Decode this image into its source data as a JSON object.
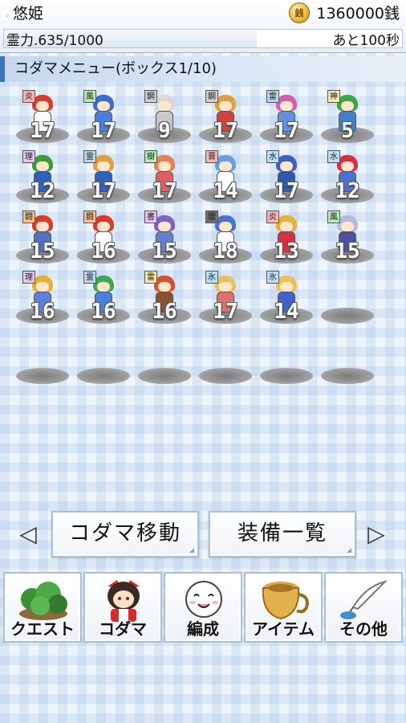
{
  "header": {
    "player_name": "悠姫",
    "coin_icon_glyph": "銭",
    "money": "1360000銭",
    "stamina_label": "霊力.635/1000",
    "stamina_fraction": 0.635,
    "remaining_time": "あと100秒"
  },
  "menu_title": "コダマメニュー(ボックス1/10)",
  "kodama": [
    {
      "badge": "炎",
      "level": "17",
      "badge_color": "#f6b4b4",
      "hair": "#d83c2a",
      "body": "#ffffff"
    },
    {
      "badge": "風",
      "level": "17",
      "badge_color": "#b6ecb6",
      "hair": "#3b6ad0",
      "body": "#4a7fe0"
    },
    {
      "badge": "鋼",
      "level": "9",
      "badge_color": "#d0d0d0",
      "hair": "#d8d8d8",
      "body": "#c8c8c8"
    },
    {
      "badge": "鋼",
      "level": "17",
      "badge_color": "#d0d0d0",
      "hair": "#e0a040",
      "body": "#d84040"
    },
    {
      "badge": "雷",
      "level": "17",
      "badge_color": "#bcd8f0",
      "hair": "#d060b0",
      "body": "#6090e0"
    },
    {
      "badge": "神",
      "level": "5",
      "badge_color": "#f6e8a8",
      "hair": "#38a848",
      "body": "#4080d0"
    },
    {
      "badge": "理",
      "level": "12",
      "badge_color": "#e0c8f0",
      "hair": "#3f9a3f",
      "body": "#3060c0"
    },
    {
      "badge": "霊",
      "level": "17",
      "badge_color": "#bcd8f0",
      "hair": "#e0a040",
      "body": "#3060c0"
    },
    {
      "badge": "樹",
      "level": "17",
      "badge_color": "#b6ecb6",
      "hair": "#e88050",
      "body": "#e06060"
    },
    {
      "badge": "晋",
      "level": "14",
      "badge_color": "#f6b4b4",
      "hair": "#6aa0e0",
      "body": "#ffffff"
    },
    {
      "badge": "水",
      "level": "17",
      "badge_color": "#b8e0f8",
      "hair": "#4060c0",
      "body": "#2f5aa8"
    },
    {
      "badge": "水",
      "level": "12",
      "badge_color": "#b8e0f8",
      "hair": "#d83040",
      "body": "#5070d0"
    },
    {
      "badge": "闘",
      "level": "15",
      "badge_color": "#f6c098",
      "hair": "#d83c2a",
      "body": "#5070c0"
    },
    {
      "badge": "闘",
      "level": "16",
      "badge_color": "#f6c098",
      "hair": "#d83c2a",
      "body": "#ffffff"
    },
    {
      "badge": "書",
      "level": "15",
      "badge_color": "#e8c0f0",
      "hair": "#8060c0",
      "body": "#6080d0"
    },
    {
      "badge": "闇",
      "level": "18",
      "badge_color": "#707070",
      "hair": "#4a70d0",
      "body": "#ffffff"
    },
    {
      "badge": "炎",
      "level": "13",
      "badge_color": "#f6b4b4",
      "hair": "#e8b030",
      "body": "#d83040"
    },
    {
      "badge": "風",
      "level": "15",
      "badge_color": "#b6ecb6",
      "hair": "#b8b8e0",
      "body": "#5050a0"
    },
    {
      "badge": "理",
      "level": "16",
      "badge_color": "#e0c8f0",
      "hair": "#e8b030",
      "body": "#6080e0"
    },
    {
      "badge": "霊",
      "level": "16",
      "badge_color": "#bcd8f0",
      "hair": "#40a850",
      "body": "#4a7fe0"
    },
    {
      "badge": "雷",
      "level": "16",
      "badge_color": "#f6e8a8",
      "hair": "#d85030",
      "body": "#8a5030"
    },
    {
      "badge": "氷",
      "level": "17",
      "badge_color": "#b8e0f8",
      "hair": "#e8c060",
      "body": "#e07070"
    },
    {
      "badge": "氷",
      "level": "14",
      "badge_color": "#b8e0f8",
      "hair": "#e8c060",
      "body": "#4060d0"
    }
  ],
  "buttons": {
    "move_kodama": "コダマ移動",
    "equipment_list": "装備一覧",
    "prev_glyph": "◁",
    "next_glyph": "▷"
  },
  "nav": [
    {
      "label": "クエスト",
      "icon": "forest-icon"
    },
    {
      "label": "コダマ",
      "icon": "shrine-maiden-icon"
    },
    {
      "label": "編成",
      "icon": "ghost-face-icon"
    },
    {
      "label": "アイテム",
      "icon": "pot-icon"
    },
    {
      "label": "その他",
      "icon": "quill-icon"
    }
  ]
}
